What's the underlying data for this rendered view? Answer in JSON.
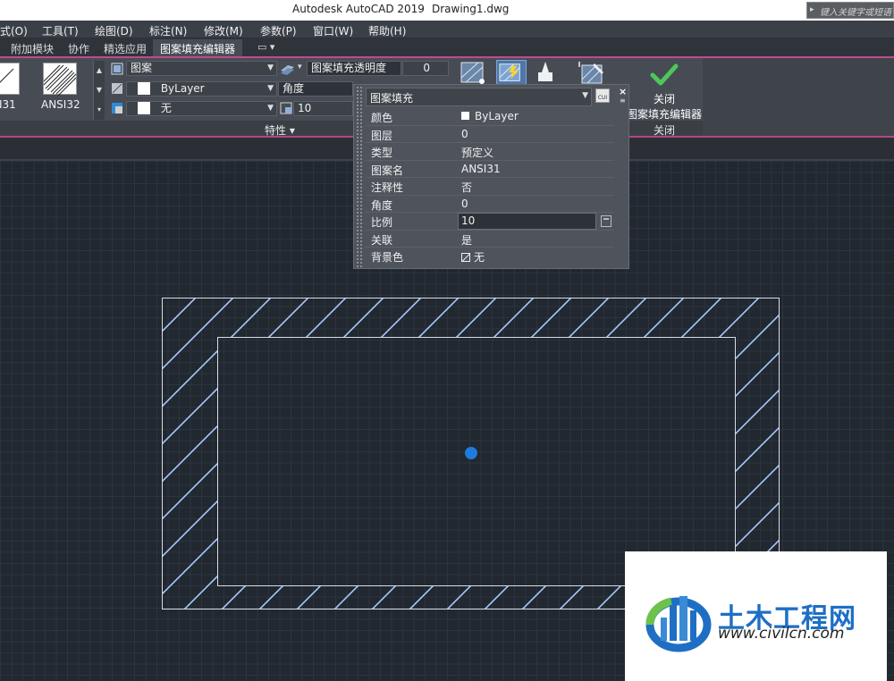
{
  "window": {
    "app_title": "Autodesk AutoCAD 2019",
    "file_name": "Drawing1.dwg",
    "search_placeholder": "键入关键字或短语"
  },
  "menu": {
    "items": [
      "式(O)",
      "工具(T)",
      "绘图(D)",
      "标注(N)",
      "修改(M)",
      "参数(P)",
      "窗口(W)",
      "帮助(H)"
    ]
  },
  "ribbon_tabs": {
    "items": [
      "附加模块",
      "协作",
      "精选应用",
      "图案填充编辑器"
    ],
    "active": "图案填充编辑器"
  },
  "ribbon": {
    "pattern_gallery": [
      "I31",
      "ANSI32"
    ],
    "hatch_type": "图案",
    "hatch_color": "ByLayer",
    "background_color": "无",
    "transparency_label": "图案填充透明度",
    "transparency_value": "0",
    "angle_label": "角度",
    "scale_value": "10",
    "properties_panel_label": "特性",
    "close_label_line1": "关闭",
    "close_label_line2": "图案填充编辑器",
    "close_panel_label": "关闭"
  },
  "quick_properties": {
    "object_type": "图案填充",
    "rows": [
      {
        "key": "颜色",
        "value": "ByLayer"
      },
      {
        "key": "图层",
        "value": "0"
      },
      {
        "key": "类型",
        "value": "预定义"
      },
      {
        "key": "图案名",
        "value": "ANSI31"
      },
      {
        "key": "注释性",
        "value": "否"
      },
      {
        "key": "角度",
        "value": "0"
      },
      {
        "key": "比例",
        "value": "10"
      },
      {
        "key": "关联",
        "value": "是"
      },
      {
        "key": "背景色",
        "value": "无"
      }
    ]
  },
  "watermark": {
    "site_name": "土木工程网",
    "url": "www.civilcn.com"
  },
  "colors": {
    "canvas_bg": "#212830",
    "hatch_line": "#a9c8ff",
    "accent_pink": "#c04a8c",
    "grip_blue": "#1e7be0",
    "check_green": "#4cc85a"
  }
}
